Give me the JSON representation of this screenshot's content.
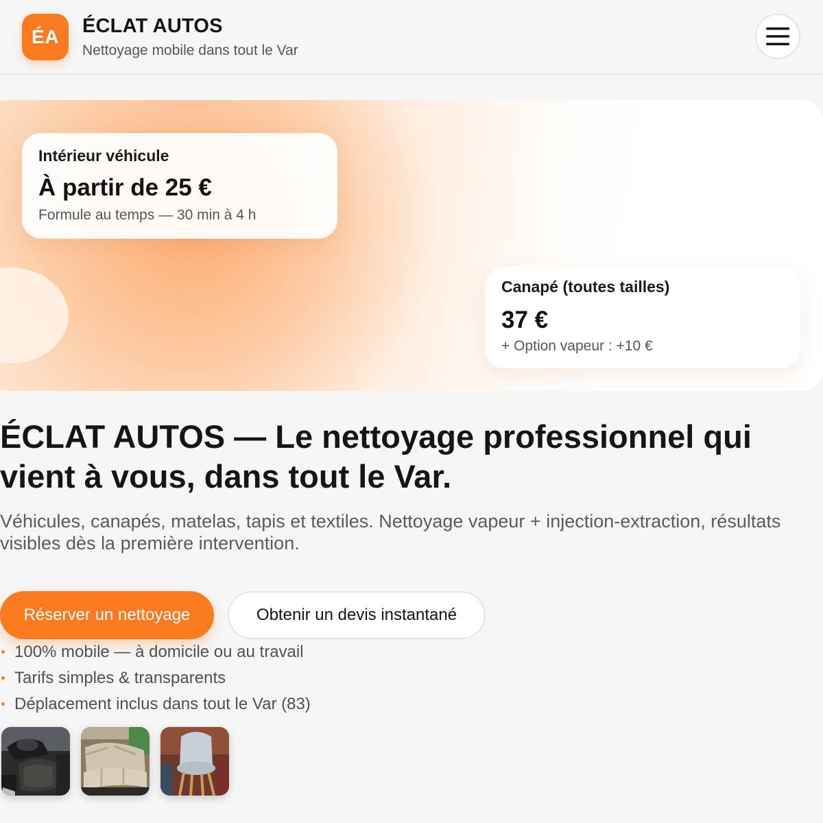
{
  "header": {
    "logo_text": "ÉA",
    "brand_name": "ÉCLAT AUTOS",
    "tagline": "Nettoyage mobile dans tout le Var",
    "menu_icon": "hamburger-menu-icon"
  },
  "hero": {
    "cards": [
      {
        "title": "Intérieur véhicule",
        "price": "À partir de 25 €",
        "note": "Formule au temps — 30 min à 4 h"
      },
      {
        "title": "Canapé (toutes tailles)",
        "price": "37 €",
        "note": "+ Option vapeur : +10 €"
      }
    ]
  },
  "main": {
    "headline": "ÉCLAT AUTOS — Le nettoyage professionnel qui vient à vous, dans tout le Var.",
    "subline": "Véhicules, canapés, matelas, tapis et textiles. Nettoyage vapeur + injection-extraction, résultats visibles dès la première intervention.",
    "primary_button": "Réserver un nettoyage",
    "secondary_button": "Obtenir un devis instantané",
    "features": [
      "100% mobile — à domicile ou au travail",
      "Tarifs simples & transparents",
      "Déplacement inclus dans tout le Var (83)"
    ]
  },
  "colors": {
    "accent": "#fb7a1f",
    "background": "#f6f6f6",
    "text": "#151515"
  }
}
